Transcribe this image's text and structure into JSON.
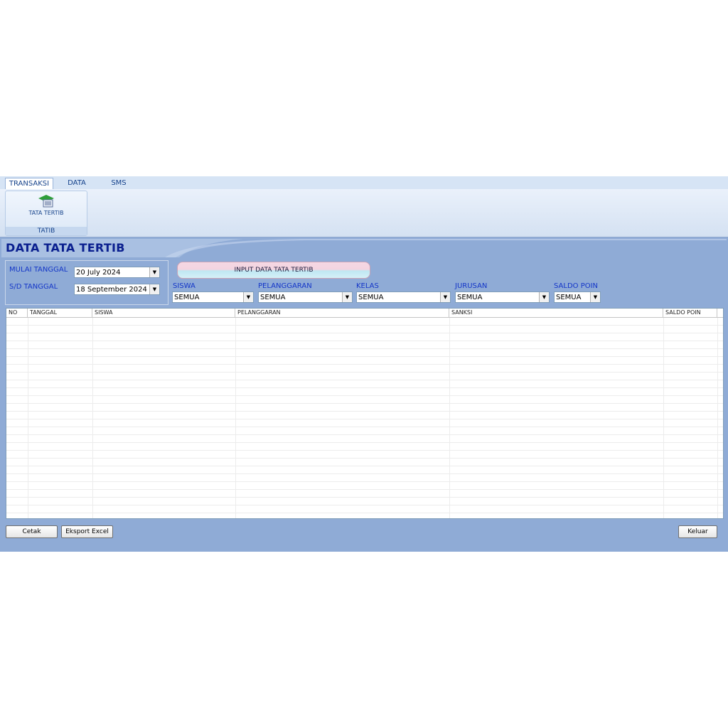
{
  "ribbon": {
    "tabs": [
      "TRANSAKSI",
      "DATA",
      "SMS"
    ],
    "active_tab": "TRANSAKSI",
    "group": {
      "button_label": "TATA TERTIB",
      "title": "TATIB"
    }
  },
  "page": {
    "title": "DATA TATA TERTIB"
  },
  "dates": {
    "start_label": "MULAI TANGGAL",
    "start_value": "20 July 2024",
    "end_label": "S/D TANGGAL",
    "end_value": "18 September 2024"
  },
  "input_button": "INPUT DATA TATA TERTIB",
  "filters": {
    "siswa": {
      "label": "SISWA",
      "value": "SEMUA"
    },
    "pelanggaran": {
      "label": "PELANGGARAN",
      "value": "SEMUA"
    },
    "kelas": {
      "label": "KELAS",
      "value": "SEMUA"
    },
    "jurusan": {
      "label": "JURUSAN",
      "value": "SEMUA"
    },
    "saldo": {
      "label": "SALDO POIN",
      "value": "SEMUA"
    }
  },
  "table": {
    "columns": [
      "NO",
      "TANGGAL",
      "SISWA",
      "PELANGGARAN",
      "SANKSI",
      "SALDO POIN"
    ],
    "rows": []
  },
  "footer": {
    "print": "Cetak",
    "export": "Eksport Excel",
    "exit": "Keluar"
  },
  "colors": {
    "background": "#8fabd6",
    "title": "#0a1f8f",
    "label": "#1436c8"
  }
}
